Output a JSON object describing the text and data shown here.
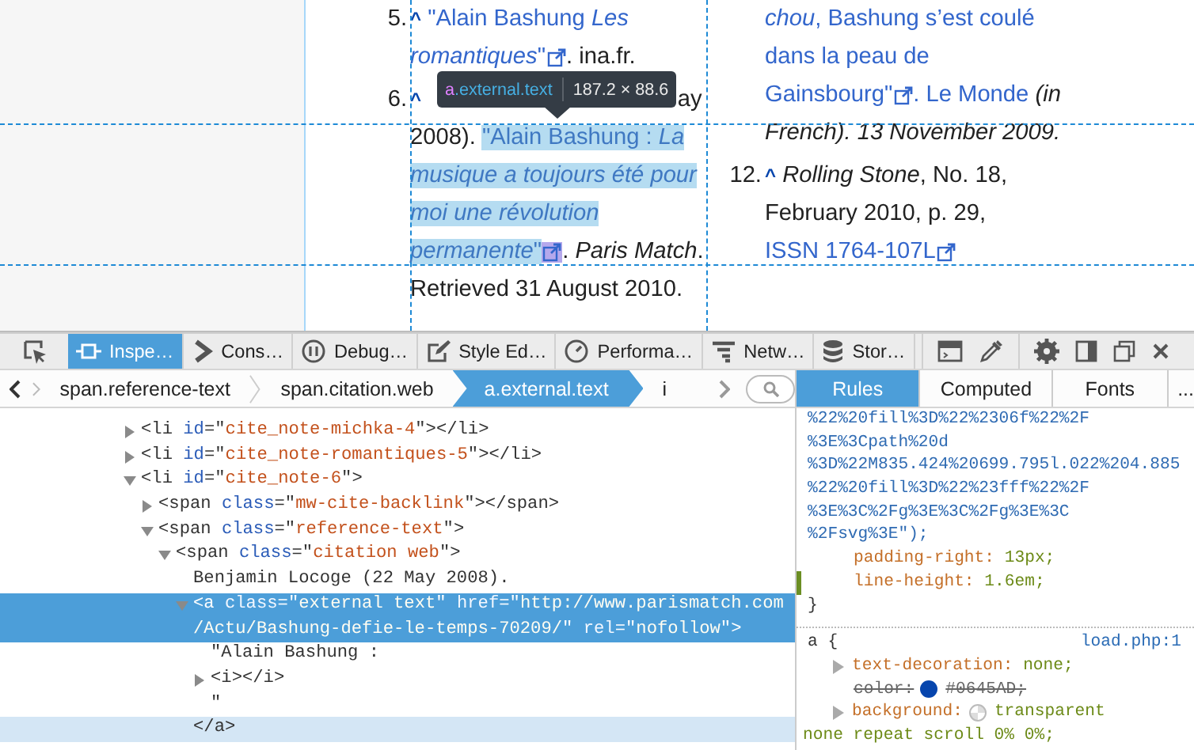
{
  "page": {
    "columns": [
      {
        "items": [
          {
            "number": "5.",
            "lines": [
              [
                {
                  "kind": "backlink",
                  "text": "^"
                },
                {
                  "kind": "link",
                  "text": " \"Alain Bashung *Les*"
                }
              ],
              [
                {
                  "kind": "link",
                  "text": "*romantiques*\""
                },
                {
                  "kind": "icon"
                },
                {
                  "kind": "text",
                  "text": ". ina.fr."
                }
              ]
            ]
          },
          {
            "number": "6.",
            "lines": [
              [
                {
                  "kind": "backlink",
                  "text": "^"
                },
                {
                  "kind": "fragment",
                  "text": "ay"
                }
              ],
              [
                {
                  "kind": "text",
                  "text": "2008). "
                },
                {
                  "kind": "link",
                  "text": "\"Alain Bashung : *La*",
                  "highlighted": true
                }
              ],
              [
                {
                  "kind": "link",
                  "text": "musique a toujours été pour",
                  "italic": true,
                  "highlighted": true
                }
              ],
              [
                {
                  "kind": "link",
                  "text": "moi une révolution",
                  "italic": true,
                  "highlighted": true
                }
              ],
              [
                {
                  "kind": "link",
                  "text": "*permanente*\"",
                  "highlighted": true
                },
                {
                  "kind": "icon",
                  "highlighted": true
                },
                {
                  "kind": "text",
                  "text": ". *Paris Match*."
                }
              ],
              [
                {
                  "kind": "text",
                  "text": "Retrieved 31 August 2010."
                }
              ]
            ]
          }
        ]
      },
      {
        "items": [
          {
            "lines": [
              [
                {
                  "kind": "link",
                  "text": "*chou*, Bashung s’est coulé"
                }
              ],
              [
                {
                  "kind": "link",
                  "text": "dans la peau de"
                }
              ],
              [
                {
                  "kind": "link",
                  "text": "Gainsbourg\""
                },
                {
                  "kind": "icon"
                },
                {
                  "kind": "link",
                  "text": ". Le Monde"
                },
                {
                  "kind": "text",
                  "text": " (in",
                  "italic": true
                }
              ],
              [
                {
                  "kind": "text",
                  "text": "French). 13 November 2009.",
                  "italic": true
                }
              ]
            ]
          },
          {
            "number": "12.",
            "lines": [
              [
                {
                  "kind": "backlink",
                  "text": "^"
                },
                {
                  "kind": "text",
                  "text": " *Rolling Stone*, No. 18,"
                }
              ],
              [
                {
                  "kind": "text",
                  "text": "February 2010, p. 29,"
                }
              ],
              [
                {
                  "kind": "link",
                  "text": "ISSN 1764-107L"
                },
                {
                  "kind": "icon"
                }
              ]
            ]
          }
        ]
      }
    ]
  },
  "highlighter": {
    "tag": "a",
    "classes": ".external.text",
    "dimensions": "187.2 × 88.6"
  },
  "toolbar": {
    "picker": {
      "kind": "picker"
    },
    "tabs": [
      {
        "kind": "inspector",
        "label": "Inspe…",
        "selected": true
      },
      {
        "kind": "console",
        "label": "Cons…",
        "selected": false
      },
      {
        "kind": "debugger",
        "label": "Debug…",
        "selected": false
      },
      {
        "kind": "style-editor",
        "label": "Style Ed…",
        "selected": false
      },
      {
        "kind": "performance",
        "label": "Performa…",
        "selected": false
      },
      {
        "kind": "network",
        "label": "Netw…",
        "selected": false
      },
      {
        "kind": "storage",
        "label": "Stor…",
        "selected": false
      }
    ],
    "buttons": [
      {
        "kind": "split-console"
      },
      {
        "kind": "eyedropper"
      },
      {
        "kind": "settings"
      },
      {
        "kind": "dock-side"
      },
      {
        "kind": "undock"
      },
      {
        "kind": "close"
      }
    ]
  },
  "breadcrumbs": [
    {
      "label": "span.reference-text",
      "selected": false
    },
    {
      "label": "span.citation.web",
      "selected": false
    },
    {
      "label": "a.external.text",
      "selected": true
    },
    {
      "label": "i",
      "selected": false
    }
  ],
  "sidebar_tabs": [
    {
      "label": "Rules",
      "selected": true
    },
    {
      "label": "Computed",
      "selected": false
    },
    {
      "label": "Fonts",
      "selected": false
    },
    {
      "label": "...",
      "selected": false
    }
  ],
  "markup": [
    {
      "kind": "element",
      "expanded": false,
      "selected": false,
      "hovered": false,
      "lines": [
        [
          {
            "kind": "tag",
            "text": "<li "
          },
          {
            "kind": "attr",
            "text": "id"
          },
          {
            "kind": "tag",
            "text": "=\""
          },
          {
            "kind": "value",
            "text": "cite_note-michka-4"
          },
          {
            "kind": "tag",
            "text": "\"></li>"
          }
        ]
      ]
    },
    {
      "kind": "element",
      "expanded": false,
      "selected": false,
      "hovered": false,
      "lines": [
        [
          {
            "kind": "tag",
            "text": "<li "
          },
          {
            "kind": "attr",
            "text": "id"
          },
          {
            "kind": "tag",
            "text": "=\""
          },
          {
            "kind": "value",
            "text": "cite_note-romantiques-5"
          },
          {
            "kind": "tag",
            "text": "\"></li>"
          }
        ]
      ]
    },
    {
      "kind": "element",
      "expanded": true,
      "selected": false,
      "hovered": false,
      "lines": [
        [
          {
            "kind": "tag",
            "text": "<li "
          },
          {
            "kind": "attr",
            "text": "id"
          },
          {
            "kind": "tag",
            "text": "=\""
          },
          {
            "kind": "value",
            "text": "cite_note-6"
          },
          {
            "kind": "tag",
            "text": "\">"
          }
        ]
      ],
      "children": [
        {
          "kind": "element",
          "expanded": false,
          "selected": false,
          "hovered": false,
          "lines": [
            [
              {
                "kind": "tag",
                "text": "<span "
              },
              {
                "kind": "attr",
                "text": "class"
              },
              {
                "kind": "tag",
                "text": "=\""
              },
              {
                "kind": "value",
                "text": "mw-cite-backlink"
              },
              {
                "kind": "tag",
                "text": "\"></span>"
              }
            ]
          ]
        },
        {
          "kind": "element",
          "expanded": true,
          "selected": false,
          "hovered": false,
          "lines": [
            [
              {
                "kind": "tag",
                "text": "<span "
              },
              {
                "kind": "attr",
                "text": "class"
              },
              {
                "kind": "tag",
                "text": "=\""
              },
              {
                "kind": "value",
                "text": "reference-text"
              },
              {
                "kind": "tag",
                "text": "\">"
              }
            ]
          ],
          "children": [
            {
              "kind": "element",
              "expanded": true,
              "selected": false,
              "hovered": false,
              "lines": [
                [
                  {
                    "kind": "tag",
                    "text": "<span "
                  },
                  {
                    "kind": "attr",
                    "text": "class"
                  },
                  {
                    "kind": "tag",
                    "text": "=\""
                  },
                  {
                    "kind": "value",
                    "text": "citation web"
                  },
                  {
                    "kind": "tag",
                    "text": "\">"
                  }
                ]
              ],
              "children": [
                {
                  "kind": "text",
                  "selected": false,
                  "hovered": false,
                  "text": "Benjamin Locoge (22 May 2008)."
                },
                {
                  "kind": "element",
                  "expanded": true,
                  "selected": true,
                  "hovered": false,
                  "lines": [
                    [
                      {
                        "kind": "tag",
                        "text": "<a "
                      },
                      {
                        "kind": "attr",
                        "text": "class"
                      },
                      {
                        "kind": "tag",
                        "text": "=\""
                      },
                      {
                        "kind": "value",
                        "text": "external text"
                      },
                      {
                        "kind": "tag",
                        "text": "\" "
                      },
                      {
                        "kind": "attr",
                        "text": "href"
                      },
                      {
                        "kind": "tag",
                        "text": "=\""
                      },
                      {
                        "kind": "value",
                        "text": "http://www.parismatch.com"
                      }
                    ],
                    [
                      {
                        "kind": "value",
                        "text": "/Actu/Bashung-defie-le-temps-70209/"
                      },
                      {
                        "kind": "tag",
                        "text": "\" "
                      },
                      {
                        "kind": "attr",
                        "text": "rel"
                      },
                      {
                        "kind": "tag",
                        "text": "=\""
                      },
                      {
                        "kind": "value",
                        "text": "nofollow"
                      },
                      {
                        "kind": "tag",
                        "text": "\">"
                      }
                    ]
                  ],
                  "children": [
                    {
                      "kind": "text",
                      "selected": false,
                      "hovered": false,
                      "text": "\"Alain Bashung :"
                    },
                    {
                      "kind": "element",
                      "expanded": false,
                      "selected": false,
                      "hovered": false,
                      "lines": [
                        [
                          {
                            "kind": "tag",
                            "text": "<i></i>"
                          }
                        ]
                      ]
                    },
                    {
                      "kind": "text",
                      "selected": false,
                      "hovered": false,
                      "text": "\""
                    }
                  ],
                  "closing": {
                    "text": "</a>",
                    "selected": false,
                    "hovered": true
                  }
                }
              ]
            }
          ]
        }
      ]
    }
  ],
  "rules": [
    {
      "kind": "url",
      "text": "%22%20fill%3D%22%2306f%22%2F"
    },
    {
      "kind": "url",
      "text": "%3E%3Cpath%20d"
    },
    {
      "kind": "url",
      "text": "%3D%22M835.424%20699.795l.022%204.885"
    },
    {
      "kind": "url",
      "text": "%22%20fill%3D%22%23fff%22%2F"
    },
    {
      "kind": "url",
      "text": "%3E%3C%2Fg%3E%3C%2Fg%3E%3C"
    },
    {
      "kind": "url",
      "text": "%2Fsvg%3E\");"
    },
    {
      "kind": "declaration",
      "name": "padding-right:",
      "value": "13px;",
      "expandable": false,
      "overridden": false,
      "changed": false
    },
    {
      "kind": "declaration",
      "name": "line-height:",
      "value": "1.6em;",
      "expandable": false,
      "overridden": false,
      "changed": true
    },
    {
      "kind": "close",
      "text": "}"
    },
    {
      "kind": "selector",
      "text": "a {",
      "source": "load.php:1"
    },
    {
      "kind": "declaration",
      "name": "text-decoration:",
      "value": "none;",
      "expandable": true,
      "overridden": false,
      "changed": false
    },
    {
      "kind": "declaration",
      "name": "color:",
      "value": "#0645AD;",
      "expandable": false,
      "overridden": true,
      "changed": false,
      "swatch": true,
      "color": "#0645ad"
    },
    {
      "kind": "declaration",
      "name": "background:",
      "value": "transparent",
      "expandable": true,
      "overridden": false,
      "changed": false,
      "swatch": true
    },
    {
      "kind": "continuation",
      "text": "none repeat scroll 0% 0%;"
    }
  ]
}
